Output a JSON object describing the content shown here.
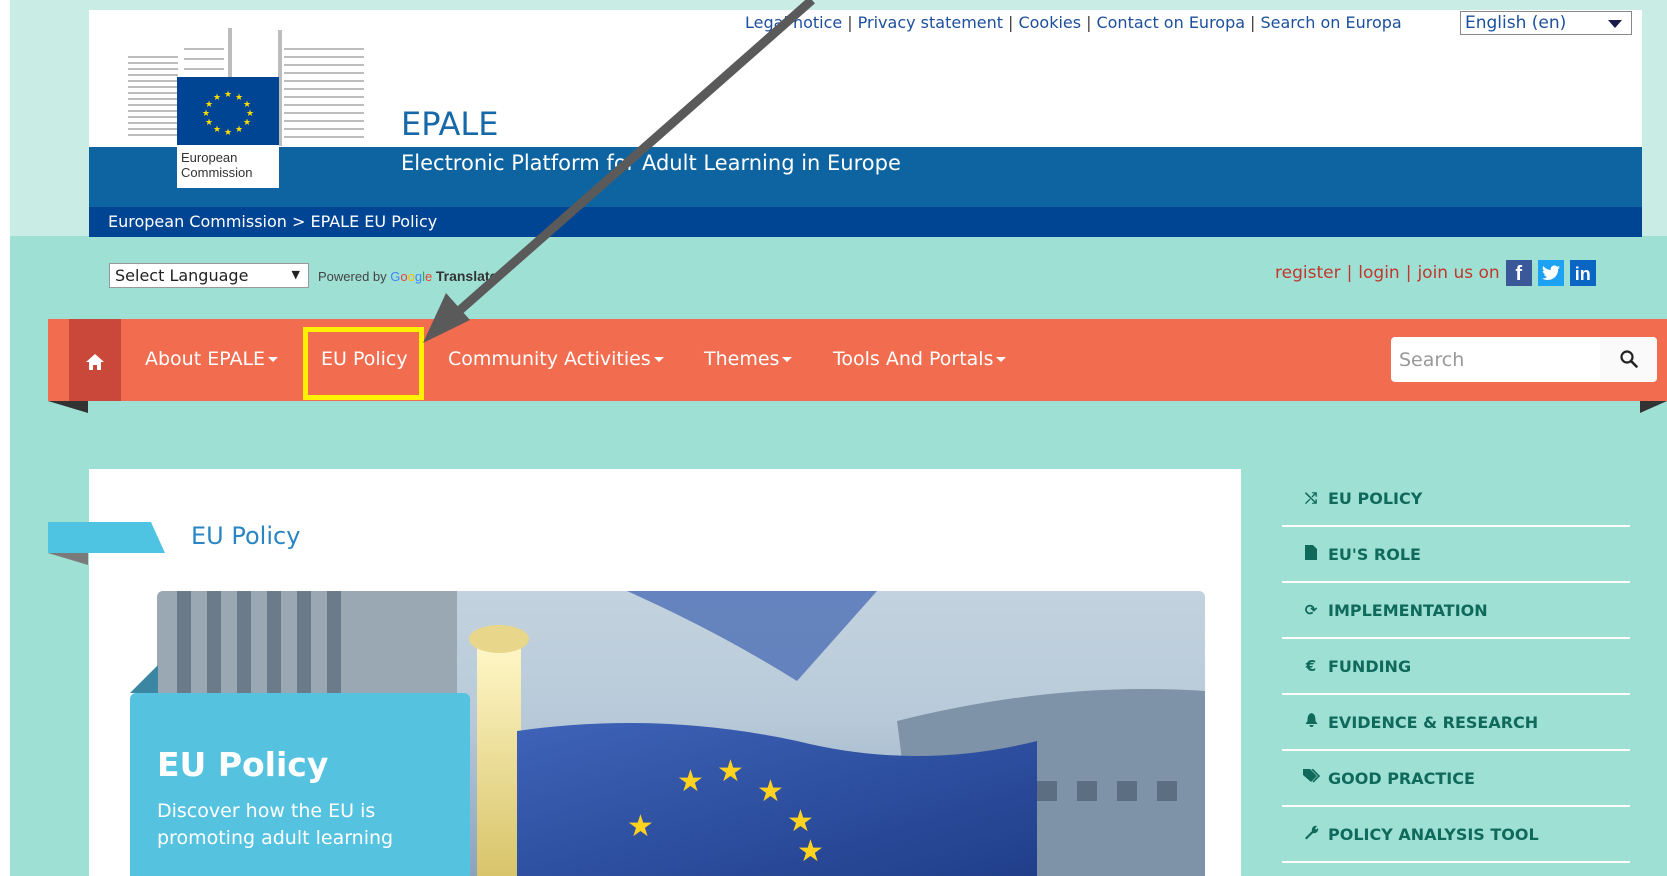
{
  "header": {
    "logo_text_line1": "European",
    "logo_text_line2": "Commission",
    "site_title": "EPALE",
    "site_subtitle": "Electronic Platform for Adult Learning in Europe",
    "breadcrumb": "European Commission > EPALE EU Policy",
    "top_links": [
      "Legal notice",
      "Privacy statement",
      "Cookies",
      "Contact on Europa",
      "Search on Europa"
    ],
    "language": "English (en)"
  },
  "translate": {
    "select_label": "Select Language",
    "powered_by": "Powered by",
    "google": "Google",
    "translate": "Translate"
  },
  "user_links": {
    "register": "register",
    "login": "login",
    "join": "join us on"
  },
  "nav": {
    "items": [
      "About EPALE",
      "EU Policy",
      "Community Activities",
      "Themes",
      "Tools And Portals"
    ],
    "search_placeholder": "Search"
  },
  "content": {
    "title": "EU Policy",
    "hero_title": "EU Policy",
    "hero_text": "Discover how the EU is promoting adult learning"
  },
  "sidebar": {
    "items": [
      {
        "label": "EU POLICY",
        "icon": "shuffle-icon"
      },
      {
        "label": "EU'S ROLE",
        "icon": "document-icon"
      },
      {
        "label": "IMPLEMENTATION",
        "icon": "refresh-icon"
      },
      {
        "label": "FUNDING",
        "icon": "euro-icon"
      },
      {
        "label": "EVIDENCE & RESEARCH",
        "icon": "bell-icon"
      },
      {
        "label": "GOOD PRACTICE",
        "icon": "tags-icon"
      },
      {
        "label": "POLICY ANALYSIS TOOL",
        "icon": "wrench-icon"
      }
    ]
  },
  "colors": {
    "nav": "#f26d50",
    "header_blue": "#0e64a0",
    "page_bg": "#9fe0d5",
    "highlight": "#fff200",
    "hero_box": "#55c2e0"
  }
}
